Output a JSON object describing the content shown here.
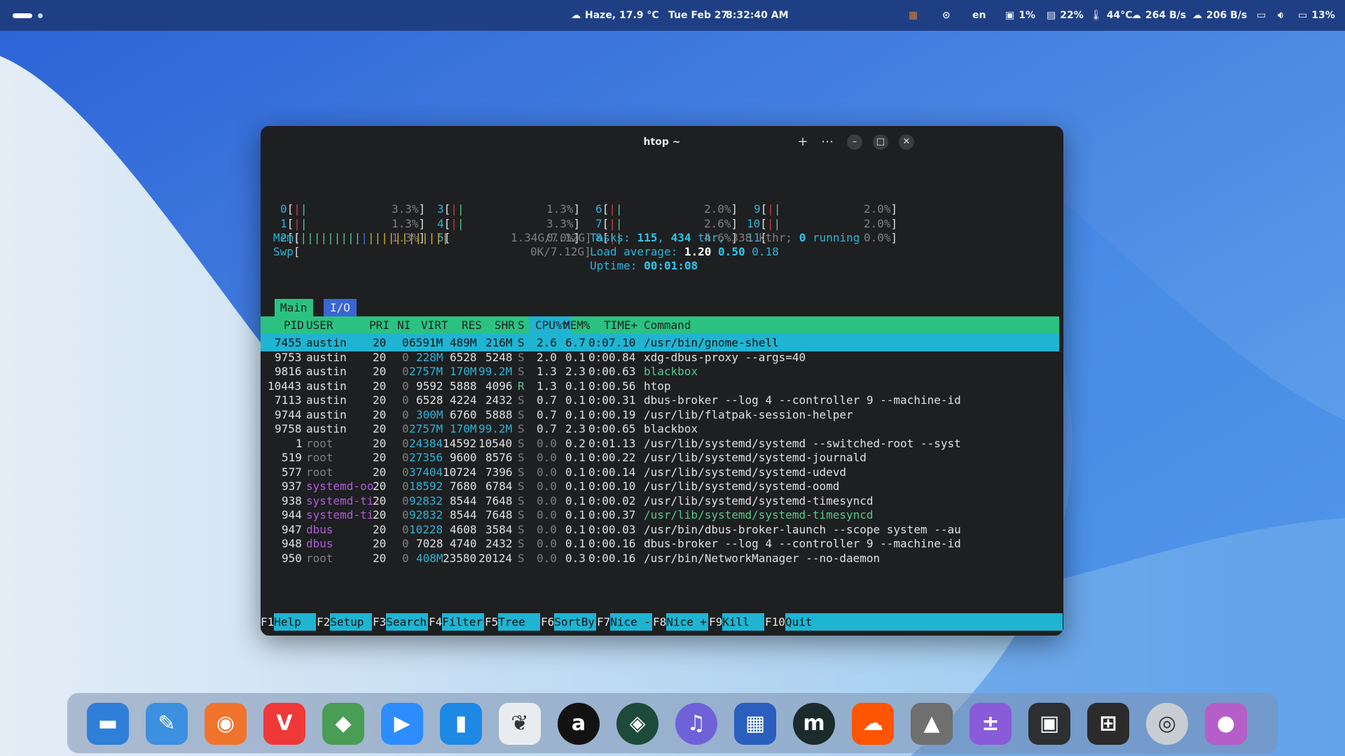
{
  "topbar": {
    "weather": "Haze, 17.9 °C",
    "date": "Tue Feb 27",
    "time": "8:32:40 AM",
    "language": "en",
    "disk": "1%",
    "memory": "22%",
    "temperature": "44°C",
    "upload": "264 B/s",
    "download": "206 B/s",
    "battery": "13%"
  },
  "window": {
    "title": "htop ~"
  },
  "meters": {
    "cpus": [
      {
        "id": "0",
        "val": "3.3%]"
      },
      {
        "id": "1",
        "val": "1.3%]"
      },
      {
        "id": "2",
        "val": "1.3%]"
      },
      {
        "id": "3",
        "val": "1.3%]"
      },
      {
        "id": "4",
        "val": "3.3%]"
      },
      {
        "id": "5",
        "val": "0.0%]"
      },
      {
        "id": "6",
        "val": "2.0%]"
      },
      {
        "id": "7",
        "val": "2.6%]"
      },
      {
        "id": "8",
        "val": "4.6%]"
      },
      {
        "id": "9",
        "val": "2.0%]"
      },
      {
        "id": "10",
        "val": "2.0%]"
      },
      {
        "id": "11",
        "val": "0.0%]"
      }
    ],
    "mem_label": "Mem",
    "mem_value": "1.34G/7.12G]",
    "swp_label": "Swp",
    "swp_value": "0K/7.12G]",
    "tasks_label": "Tasks:",
    "tasks": "115",
    "thr": "434",
    "thr_label": "thr,",
    "kthr": "338 kthr;",
    "running": "0",
    "running_label": "running",
    "load_label": "Load average:",
    "load1": "1.20",
    "load5": "0.50",
    "load15": "0.18",
    "uptime_label": "Uptime:",
    "uptime": "00:01:08"
  },
  "tabs": [
    "Main",
    "I/O"
  ],
  "columns": [
    "PID",
    "USER",
    "PRI",
    "NI",
    "VIRT",
    "RES",
    "SHR",
    "S",
    "CPU%▽",
    "MEM%",
    "TIME+",
    "Command"
  ],
  "processes": [
    {
      "pid": "7455",
      "user": "austin",
      "pri": "20",
      "ni": "0",
      "virt": "6591M",
      "res": "489M",
      "shr": "216M",
      "s": "S",
      "cpu": "2.6",
      "mem": "6.7",
      "time": "0:07.10",
      "cmd": "/usr/bin/gnome-shell"
    },
    {
      "pid": "9753",
      "user": "austin",
      "pri": "20",
      "ni": "0",
      "virt": "228M",
      "res": "6528",
      "shr": "5248",
      "s": "S",
      "cpu": "2.0",
      "mem": "0.1",
      "time": "0:00.84",
      "cmd": "xdg-dbus-proxy --args=40"
    },
    {
      "pid": "9816",
      "user": "austin",
      "pri": "20",
      "ni": "0",
      "virt": "2757M",
      "res": "170M",
      "shr": "99.2M",
      "s": "S",
      "cpu": "1.3",
      "mem": "2.3",
      "time": "0:00.63",
      "cmd": "blackbox"
    },
    {
      "pid": "10443",
      "user": "austin",
      "pri": "20",
      "ni": "0",
      "virt": "9592",
      "res": "5888",
      "shr": "4096",
      "s": "R",
      "cpu": "1.3",
      "mem": "0.1",
      "time": "0:00.56",
      "cmd": "htop"
    },
    {
      "pid": "7113",
      "user": "austin",
      "pri": "20",
      "ni": "0",
      "virt": "6528",
      "res": "4224",
      "shr": "2432",
      "s": "S",
      "cpu": "0.7",
      "mem": "0.1",
      "time": "0:00.31",
      "cmd": "dbus-broker --log 4 --controller 9 --machine-id"
    },
    {
      "pid": "9744",
      "user": "austin",
      "pri": "20",
      "ni": "0",
      "virt": "300M",
      "res": "6760",
      "shr": "5888",
      "s": "S",
      "cpu": "0.7",
      "mem": "0.1",
      "time": "0:00.19",
      "cmd": "/usr/lib/flatpak-session-helper"
    },
    {
      "pid": "9758",
      "user": "austin",
      "pri": "20",
      "ni": "0",
      "virt": "2757M",
      "res": "170M",
      "shr": "99.2M",
      "s": "S",
      "cpu": "0.7",
      "mem": "2.3",
      "time": "0:00.65",
      "cmd": "blackbox"
    },
    {
      "pid": "1",
      "user": "root",
      "pri": "20",
      "ni": "0",
      "virt": "24384",
      "res": "14592",
      "shr": "10540",
      "s": "S",
      "cpu": "0.0",
      "mem": "0.2",
      "time": "0:01.13",
      "cmd": "/usr/lib/systemd/systemd --switched-root --syst"
    },
    {
      "pid": "519",
      "user": "root",
      "pri": "20",
      "ni": "0",
      "virt": "27356",
      "res": "9600",
      "shr": "8576",
      "s": "S",
      "cpu": "0.0",
      "mem": "0.1",
      "time": "0:00.22",
      "cmd": "/usr/lib/systemd/systemd-journald"
    },
    {
      "pid": "577",
      "user": "root",
      "pri": "20",
      "ni": "0",
      "virt": "37404",
      "res": "10724",
      "shr": "7396",
      "s": "S",
      "cpu": "0.0",
      "mem": "0.1",
      "time": "0:00.14",
      "cmd": "/usr/lib/systemd/systemd-udevd"
    },
    {
      "pid": "937",
      "user": "systemd-oo",
      "pri": "20",
      "ni": "0",
      "virt": "18592",
      "res": "7680",
      "shr": "6784",
      "s": "S",
      "cpu": "0.0",
      "mem": "0.1",
      "time": "0:00.10",
      "cmd": "/usr/lib/systemd/systemd-oomd"
    },
    {
      "pid": "938",
      "user": "systemd-ti",
      "pri": "20",
      "ni": "0",
      "virt": "92832",
      "res": "8544",
      "shr": "7648",
      "s": "S",
      "cpu": "0.0",
      "mem": "0.1",
      "time": "0:00.02",
      "cmd": "/usr/lib/systemd/systemd-timesyncd"
    },
    {
      "pid": "944",
      "user": "systemd-ti",
      "pri": "20",
      "ni": "0",
      "virt": "92832",
      "res": "8544",
      "shr": "7648",
      "s": "S",
      "cpu": "0.0",
      "mem": "0.1",
      "time": "0:00.37",
      "cmd": "/usr/lib/systemd/systemd-timesyncd"
    },
    {
      "pid": "947",
      "user": "dbus",
      "pri": "20",
      "ni": "0",
      "virt": "10228",
      "res": "4608",
      "shr": "3584",
      "s": "S",
      "cpu": "0.0",
      "mem": "0.1",
      "time": "0:00.03",
      "cmd": "/usr/bin/dbus-broker-launch --scope system --au"
    },
    {
      "pid": "948",
      "user": "dbus",
      "pri": "20",
      "ni": "0",
      "virt": "7028",
      "res": "4740",
      "shr": "2432",
      "s": "S",
      "cpu": "0.0",
      "mem": "0.1",
      "time": "0:00.16",
      "cmd": "dbus-broker --log 4 --controller 9 --machine-id"
    },
    {
      "pid": "950",
      "user": "root",
      "pri": "20",
      "ni": "0",
      "virt": "408M",
      "res": "23580",
      "shr": "20124",
      "s": "S",
      "cpu": "0.0",
      "mem": "0.3",
      "time": "0:00.16",
      "cmd": "/usr/bin/NetworkManager --no-daemon"
    }
  ],
  "fkeys": [
    {
      "key": "F1",
      "label": "Help"
    },
    {
      "key": "F2",
      "label": "Setup"
    },
    {
      "key": "F3",
      "label": "Search"
    },
    {
      "key": "F4",
      "label": "Filter"
    },
    {
      "key": "F5",
      "label": "Tree"
    },
    {
      "key": "F6",
      "label": "SortBy"
    },
    {
      "key": "F7",
      "label": "Nice -"
    },
    {
      "key": "F8",
      "label": "Nice +"
    },
    {
      "key": "F9",
      "label": "Kill"
    },
    {
      "key": "F10",
      "label": "Quit"
    }
  ],
  "dock": [
    {
      "name": "files-icon",
      "color": "#2f7fd8"
    },
    {
      "name": "text-editor-icon",
      "color": "#3d8fe0"
    },
    {
      "name": "firefox-icon",
      "color": "#f0742b"
    },
    {
      "name": "vivaldi-icon",
      "color": "#ef3939"
    },
    {
      "name": "layers-icon",
      "color": "#4a9d54"
    },
    {
      "name": "zoom-icon",
      "color": "#2d8cff"
    },
    {
      "name": "bookmarks-icon",
      "color": "#1e88e5"
    },
    {
      "name": "book-reader-icon",
      "color": "#e9ecef"
    },
    {
      "name": "amberol-icon",
      "color": "#121212"
    },
    {
      "name": "android-studio-icon",
      "color": "#1d4a3a"
    },
    {
      "name": "music-icon",
      "color": "#6f62d8"
    },
    {
      "name": "pixel-app-icon",
      "color": "#2b5fbd"
    },
    {
      "name": "mastodon-icon",
      "color": "#1b2b2b"
    },
    {
      "name": "soundcloud-icon",
      "color": "#ff5500"
    },
    {
      "name": "inkscape-icon",
      "color": "#6f6f6f"
    },
    {
      "name": "calculator-icon",
      "color": "#8a5bd8"
    },
    {
      "name": "screenshot-icon",
      "color": "#2d2f33"
    },
    {
      "name": "mixer-icon",
      "color": "#2b2b2b"
    },
    {
      "name": "disk-icon",
      "color": "#c8cdd3"
    },
    {
      "name": "recorder-icon",
      "color": "#b65ec8"
    }
  ]
}
